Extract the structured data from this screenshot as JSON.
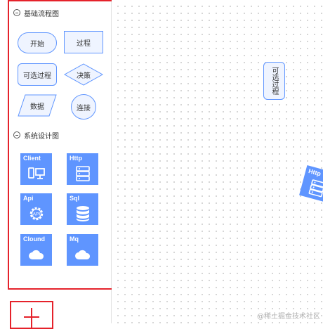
{
  "sidebar": {
    "groups": [
      {
        "title": "基础流程图",
        "icon": "collapse-minus-icon"
      },
      {
        "title": "系统设计图",
        "icon": "collapse-minus-icon"
      }
    ],
    "basic_shapes": {
      "start": "开始",
      "process": "过程",
      "optional_process": "可选过程",
      "decision": "决策",
      "data": "数据",
      "connector": "连接"
    },
    "system_tiles": [
      {
        "name": "Client",
        "icon": "client-devices-icon"
      },
      {
        "name": "Http",
        "icon": "server-rack-icon"
      },
      {
        "name": "Api",
        "icon": "api-gear-icon"
      },
      {
        "name": "Sql",
        "icon": "database-icon"
      },
      {
        "name": "Clound",
        "icon": "cloud-icon"
      },
      {
        "name": "Mq",
        "icon": "cloud-icon"
      }
    ],
    "add_button_icon": "plus-icon"
  },
  "canvas": {
    "nodes": [
      {
        "label": "可选过程",
        "kind": "optional-process"
      },
      {
        "label": "Http",
        "kind": "http-tile",
        "icon": "server-rack-icon"
      }
    ]
  },
  "watermark": "@稀土掘金技术社区",
  "colors": {
    "accent": "#5f95ff",
    "shape_fill": "#eff4ff",
    "highlight_border": "#e5222b",
    "grid_dot": "#c9c9c9"
  }
}
